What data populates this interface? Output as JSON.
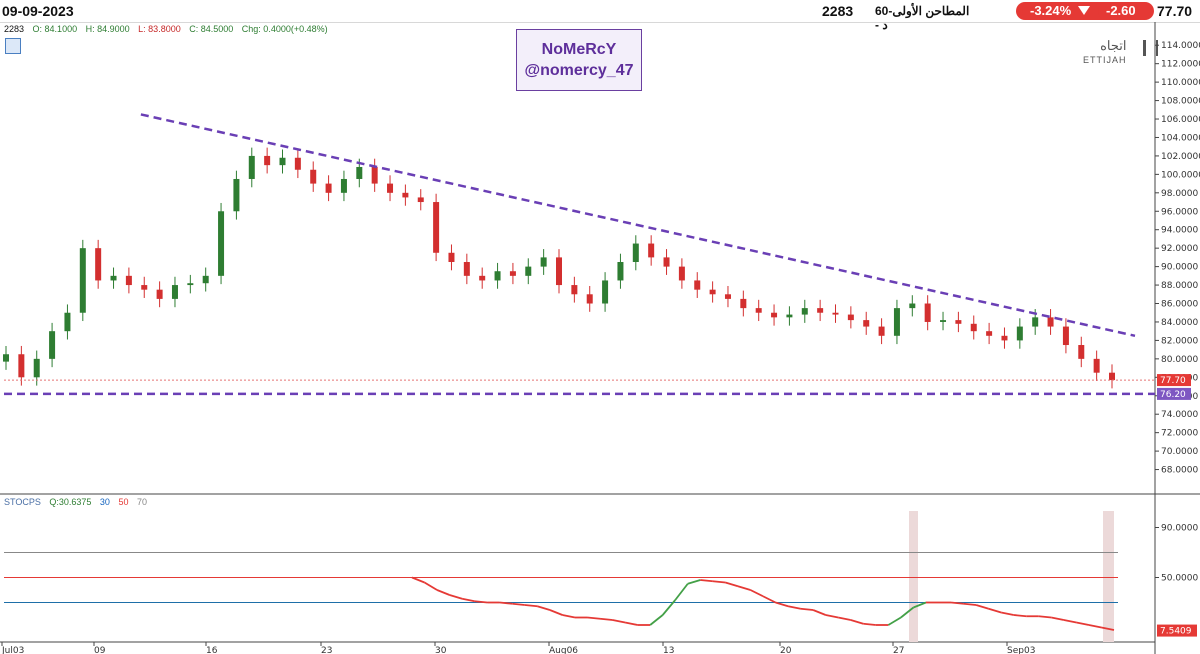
{
  "header": {
    "date": "09-09-2023",
    "symbol_code": "2283",
    "name_ar": "المطاحن الأولى-60 د -",
    "change_pct": "-3.24%",
    "change_abs": "-2.60",
    "last_price": "77.70"
  },
  "ohlc": {
    "symbol": "2283",
    "open": "O: 84.1000",
    "high": "H: 84.9000",
    "low": "L: 83.8000",
    "close": "C: 84.5000",
    "chg": "Chg: 0.4000(+0.48%)"
  },
  "watermark": {
    "line1": "NoMeRcY",
    "line2": "@nomercy_47"
  },
  "brand": {
    "ar": "اتجاه",
    "en": "ETTIJAH"
  },
  "stoch": {
    "name": "STOCPS",
    "value": "Q:30.6375",
    "l1": "30",
    "l2": "50",
    "l3": "70"
  },
  "colors": {
    "up": "#2e7d32",
    "down": "#d32f2f",
    "trend": "#6a3fb5",
    "stoch_line": "#e53935",
    "stoch_up": "#43a047"
  },
  "chart_data": [
    {
      "type": "candlestick",
      "title": "",
      "ylim": [
        66,
        115
      ],
      "y_ticks": [
        "114.0000",
        "112.0000",
        "110.0000",
        "108.0000",
        "106.0000",
        "104.0000",
        "102.0000",
        "100.0000",
        "98.0000",
        "96.0000",
        "94.0000",
        "92.0000",
        "90.0000",
        "88.0000",
        "86.0000",
        "84.0000",
        "82.0000",
        "80.0000",
        "78.0000",
        "76.0000",
        "74.0000",
        "72.0000",
        "70.0000",
        "68.0000"
      ],
      "x_tick_labels": [
        "Jul03",
        "09",
        "16",
        "23",
        "30",
        "Aug06",
        "13",
        "20",
        "27",
        "Sep03"
      ],
      "price_tags": [
        {
          "label": "77.70",
          "value": 77.7,
          "color": "#e53935"
        },
        {
          "label": "76.20",
          "value": 76.2,
          "color": "#7e57c2"
        }
      ],
      "support_level": 76.2,
      "trendline": [
        {
          "i": 0.12,
          "v": 106.5
        },
        {
          "i": 1.0,
          "v": 82.5
        }
      ],
      "closes": [
        80.5,
        78.0,
        80.0,
        83.0,
        85.0,
        92.0,
        88.5,
        89.0,
        88.0,
        87.5,
        86.5,
        88.0,
        88.2,
        89.0,
        96.0,
        99.5,
        102.0,
        101.0,
        101.8,
        100.5,
        99.0,
        98.0,
        99.5,
        100.8,
        99.0,
        98.0,
        97.5,
        97.0,
        91.5,
        90.5,
        89.0,
        88.5,
        89.5,
        89.0,
        90.0,
        91.0,
        88.0,
        87.0,
        86.0,
        88.5,
        90.5,
        92.5,
        91.0,
        90.0,
        88.5,
        87.5,
        87.0,
        86.5,
        85.5,
        85.0,
        84.5,
        84.8,
        85.5,
        85.0,
        84.8,
        84.2,
        83.5,
        82.5,
        85.5,
        86.0,
        84.0,
        84.2,
        83.8,
        83.0,
        82.5,
        82.0,
        83.5,
        84.5,
        83.5,
        81.5,
        80.0,
        78.5,
        77.7
      ]
    },
    {
      "type": "line",
      "title": "",
      "ylim": [
        0,
        100
      ],
      "y_ticks": [
        "90.0000",
        "50.0000",
        "7.5409"
      ],
      "levels": [
        70,
        50,
        30
      ],
      "value_tag": "7.5409",
      "values": [
        50,
        46,
        40,
        36,
        33,
        31,
        30,
        30,
        29,
        28,
        27,
        24,
        20,
        18,
        18,
        17,
        16,
        14,
        12,
        12,
        20,
        32,
        45,
        48,
        47,
        46,
        43,
        40,
        35,
        30,
        27,
        25,
        24,
        20,
        18,
        16,
        13,
        12,
        12,
        18,
        26,
        30,
        30,
        30,
        29,
        28,
        25,
        22,
        20,
        19,
        19,
        18,
        16,
        14,
        12,
        10,
        8
      ]
    }
  ]
}
